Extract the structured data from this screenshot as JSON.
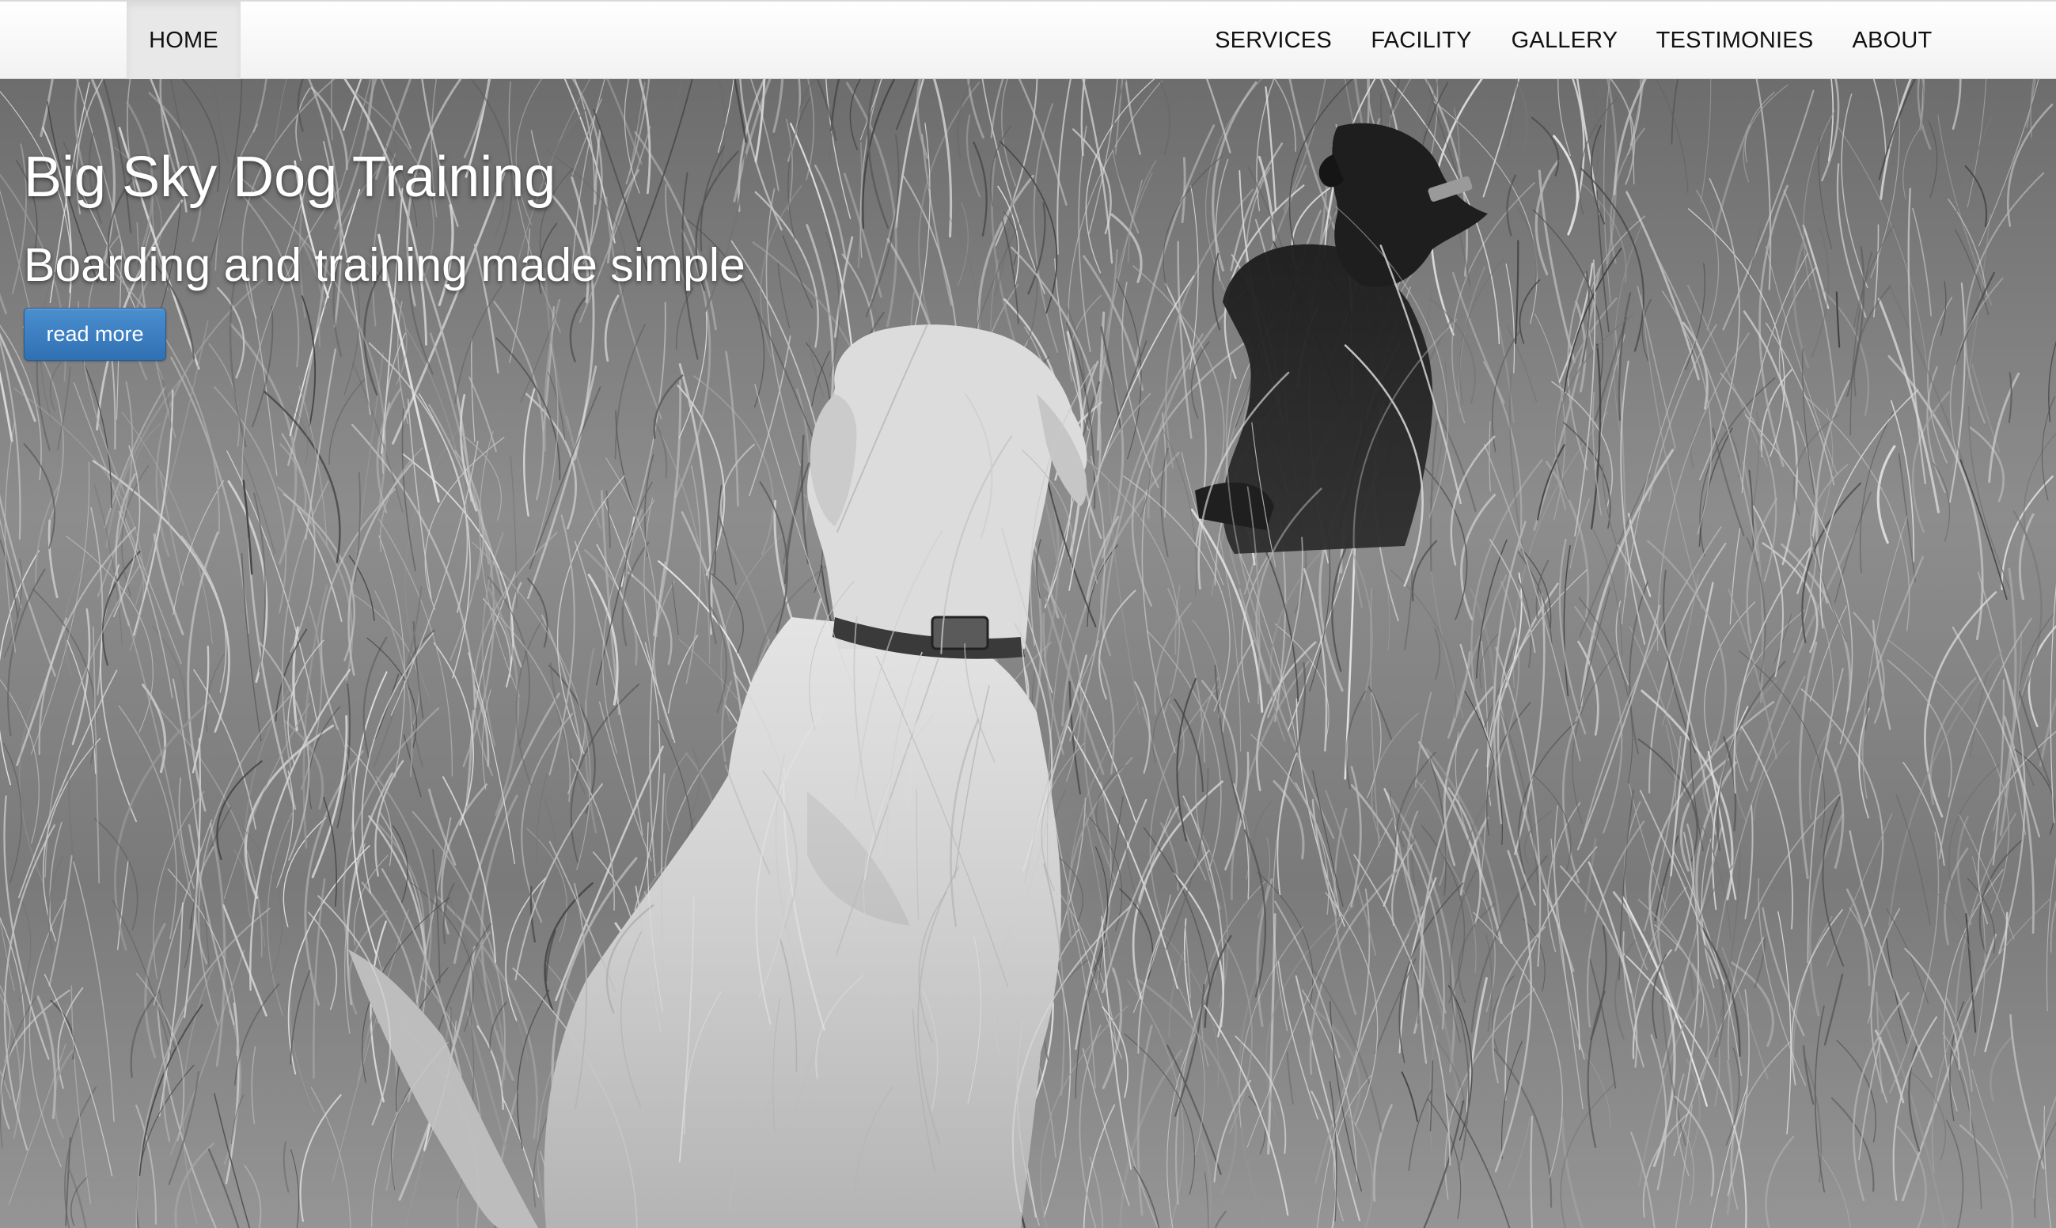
{
  "nav": {
    "items": [
      {
        "label": "HOME",
        "active": true
      },
      {
        "label": "SERVICES",
        "active": false
      },
      {
        "label": "FACILITY",
        "active": false
      },
      {
        "label": "GALLERY",
        "active": false
      },
      {
        "label": "TESTIMONIES",
        "active": false
      },
      {
        "label": "ABOUT",
        "active": false
      }
    ]
  },
  "hero": {
    "title": "Big Sky Dog Training",
    "subtitle": "Boarding and training made simple",
    "button_label": "read more",
    "image": {
      "subject": "black-and-white photo of a light-colored dog and a dark dog sitting in tall grass",
      "tone": "grayscale"
    }
  },
  "colors": {
    "button": "#337ab7",
    "navbar_bg": "#f7f7f7",
    "active_tab_bg": "#e8e8e8",
    "hero_text": "#ffffff"
  }
}
